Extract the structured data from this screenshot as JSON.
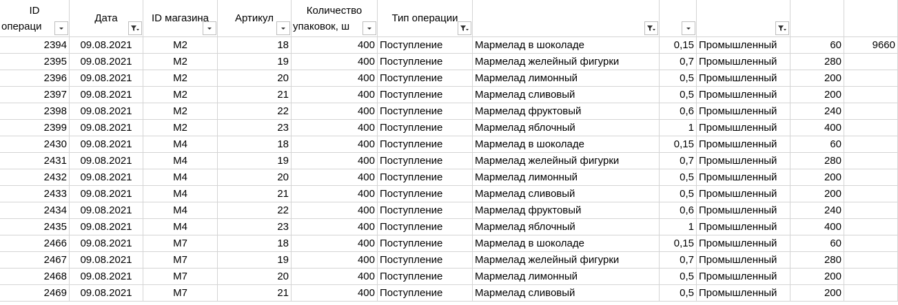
{
  "headers": [
    {
      "line1": "ID",
      "line2": "операци",
      "filter_icon": "dropdown-arrow-icon"
    },
    {
      "line1": "Дата",
      "line2": "",
      "filter_icon": "filter-funnel-icon"
    },
    {
      "line1": "ID магазина",
      "line2": "",
      "filter_icon": "dropdown-arrow-icon"
    },
    {
      "line1": "Артикул",
      "line2": "",
      "filter_icon": "dropdown-arrow-icon"
    },
    {
      "line1": "Количество",
      "line2": "упаковок, ш",
      "filter_icon": "dropdown-arrow-icon"
    },
    {
      "line1": "Тип операции",
      "line2": "",
      "filter_icon": "filter-funnel-icon"
    },
    {
      "line1": "",
      "line2": "",
      "filter_icon": "filter-funnel-icon"
    },
    {
      "line1": "",
      "line2": "",
      "filter_icon": "dropdown-arrow-icon"
    },
    {
      "line1": "",
      "line2": "",
      "filter_icon": "filter-funnel-icon"
    },
    {
      "line1": "",
      "line2": "",
      "filter_icon": ""
    },
    {
      "line1": "",
      "line2": "",
      "filter_icon": ""
    }
  ],
  "rows": [
    [
      "2394",
      "09.08.2021",
      "M2",
      "18",
      "400",
      "Поступление",
      "Мармелад в шоколаде",
      "0,15",
      "Промышленный",
      "60",
      "9660"
    ],
    [
      "2395",
      "09.08.2021",
      "M2",
      "19",
      "400",
      "Поступление",
      "Мармелад желейный фигурки",
      "0,7",
      "Промышленный",
      "280",
      ""
    ],
    [
      "2396",
      "09.08.2021",
      "M2",
      "20",
      "400",
      "Поступление",
      "Мармелад лимонный",
      "0,5",
      "Промышленный",
      "200",
      ""
    ],
    [
      "2397",
      "09.08.2021",
      "M2",
      "21",
      "400",
      "Поступление",
      "Мармелад сливовый",
      "0,5",
      "Промышленный",
      "200",
      ""
    ],
    [
      "2398",
      "09.08.2021",
      "M2",
      "22",
      "400",
      "Поступление",
      "Мармелад фруктовый",
      "0,6",
      "Промышленный",
      "240",
      ""
    ],
    [
      "2399",
      "09.08.2021",
      "M2",
      "23",
      "400",
      "Поступление",
      "Мармелад яблочный",
      "1",
      "Промышленный",
      "400",
      ""
    ],
    [
      "2430",
      "09.08.2021",
      "M4",
      "18",
      "400",
      "Поступление",
      "Мармелад в шоколаде",
      "0,15",
      "Промышленный",
      "60",
      ""
    ],
    [
      "2431",
      "09.08.2021",
      "M4",
      "19",
      "400",
      "Поступление",
      "Мармелад желейный фигурки",
      "0,7",
      "Промышленный",
      "280",
      ""
    ],
    [
      "2432",
      "09.08.2021",
      "M4",
      "20",
      "400",
      "Поступление",
      "Мармелад лимонный",
      "0,5",
      "Промышленный",
      "200",
      ""
    ],
    [
      "2433",
      "09.08.2021",
      "M4",
      "21",
      "400",
      "Поступление",
      "Мармелад сливовый",
      "0,5",
      "Промышленный",
      "200",
      ""
    ],
    [
      "2434",
      "09.08.2021",
      "M4",
      "22",
      "400",
      "Поступление",
      "Мармелад фруктовый",
      "0,6",
      "Промышленный",
      "240",
      ""
    ],
    [
      "2435",
      "09.08.2021",
      "M4",
      "23",
      "400",
      "Поступление",
      "Мармелад яблочный",
      "1",
      "Промышленный",
      "400",
      ""
    ],
    [
      "2466",
      "09.08.2021",
      "M7",
      "18",
      "400",
      "Поступление",
      "Мармелад в шоколаде",
      "0,15",
      "Промышленный",
      "60",
      ""
    ],
    [
      "2467",
      "09.08.2021",
      "M7",
      "19",
      "400",
      "Поступление",
      "Мармелад желейный фигурки",
      "0,7",
      "Промышленный",
      "280",
      ""
    ],
    [
      "2468",
      "09.08.2021",
      "M7",
      "20",
      "400",
      "Поступление",
      "Мармелад лимонный",
      "0,5",
      "Промышленный",
      "200",
      ""
    ],
    [
      "2469",
      "09.08.2021",
      "M7",
      "21",
      "400",
      "Поступление",
      "Мармелад сливовый",
      "0,5",
      "Промышленный",
      "200",
      ""
    ]
  ]
}
